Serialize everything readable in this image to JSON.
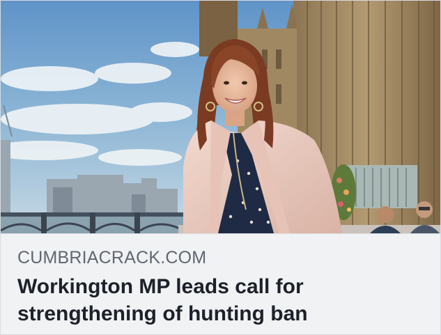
{
  "link_preview": {
    "image_alt": "Woman with long auburn hair in a pale pink blazer sitting on a terrace beside the Houses of Parliament, with a river bridge and city skyline behind her",
    "domain": "CUMBRIACRACK.COM",
    "headline": "Workington MP leads call for strengthening of hunting ban"
  },
  "colors": {
    "caption_background": "#f1f2f4",
    "domain_text": "#606770",
    "headline_text": "#1d2129",
    "sky": "#8fb8d8"
  }
}
